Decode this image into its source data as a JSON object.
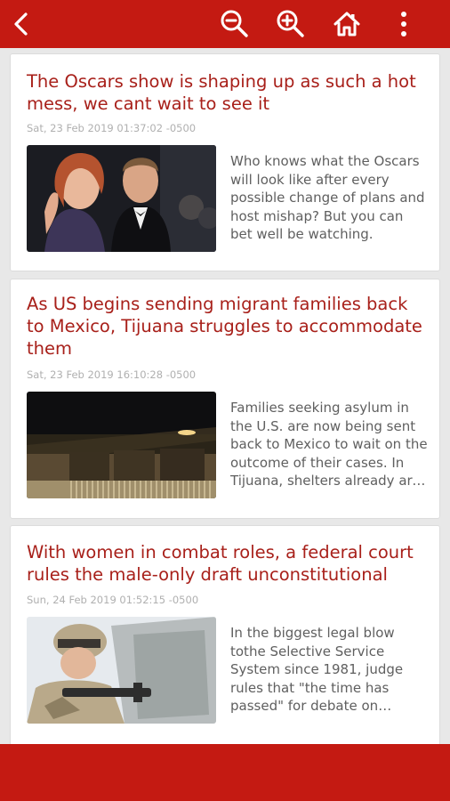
{
  "toolbar": {
    "back_icon": "chevron-left-icon",
    "zoom_out_icon": "zoom-out-icon",
    "zoom_in_icon": "zoom-in-icon",
    "home_icon": "home-icon",
    "more_icon": "more-vertical-icon",
    "color": "#c41a12"
  },
  "articles": [
    {
      "title": "The Oscars show is shaping up as such a hot mess, we cant wait to see it",
      "date": "Sat, 23 Feb 2019 01:37:02 -0500",
      "summary": "Who knows what the Oscars will look like after every possible change of plans and host mishap? But you can bet well be watching."
    },
    {
      "title": "As US begins sending migrant families back to Mexico, Tijuana struggles to accommodate them",
      "date": "Sat, 23 Feb 2019 16:10:28 -0500",
      "summary": "Families seeking asylum in the U.S. are now being sent back to Mexico to wait on the outcome of their cases. In Tijuana, shelters already are struggling."
    },
    {
      "title": "With women in combat roles, a federal court rules the male-only draft unconstitutional",
      "date": "Sun, 24 Feb 2019 01:52:15 -0500",
      "summary": "In the biggest legal blow tothe Selective Service System since 1981, judge rules that \"the time has passed\" for debate on women in the military."
    }
  ],
  "colors": {
    "title": "#a8201a",
    "date": "#b0b0b0",
    "summary": "#5f5f5f",
    "background": "#e8e8e8"
  }
}
